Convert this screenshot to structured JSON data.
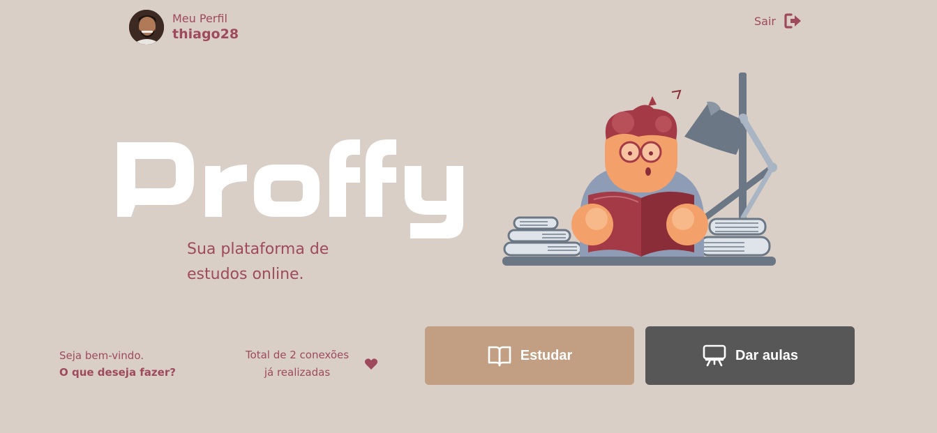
{
  "header": {
    "profile_caption": "Meu Perfil",
    "profile_name": "thiago28",
    "logout_label": "Sair"
  },
  "hero": {
    "logo_text": "Proffy",
    "tagline_line1": "Sua plataforma de",
    "tagline_line2": "estudos online."
  },
  "footer": {
    "welcome_line": "Seja bem-vindo.",
    "welcome_question": "O que deseja fazer?",
    "connections_line1": "Total de 2 conexões",
    "connections_line2": "já realizadas",
    "study_label": "Estudar",
    "teach_label": "Dar aulas"
  },
  "colors": {
    "background": "#d9cfc7",
    "accent": "#9e4a5c",
    "study_button": "#c29f82",
    "teach_button": "#575757"
  },
  "icons": {
    "logout": "sign-out-icon",
    "heart": "heart-icon",
    "study": "open-book-icon",
    "teach": "presentation-board-icon"
  }
}
